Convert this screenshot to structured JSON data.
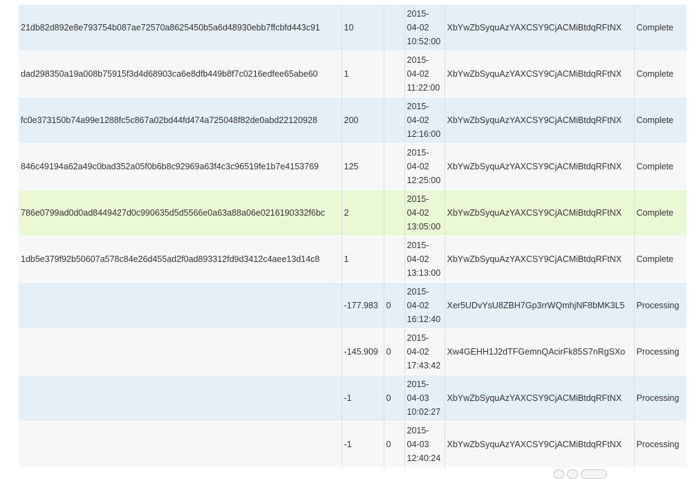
{
  "transactions": {
    "rows": [
      {
        "hash": "21db82d892e8e793754b087ae72570a8625450b5a6d48930ebb7ffcbfd443c91",
        "amount": "10",
        "confirmations": "",
        "date": "2015-",
        "date2": "04-02",
        "time": "10:52:00",
        "address": "XbYwZbSyquAzYAXCSY9CjACMiBtdqRFtNX",
        "status": "Complete"
      },
      {
        "hash": "dad298350a19a008b75915f3d4d68903ca6e8dfb449b8f7c0216edfee65abe60",
        "amount": "1",
        "confirmations": "",
        "date": "2015-",
        "date2": "04-02",
        "time": "11:22:00",
        "address": "XbYwZbSyquAzYAXCSY9CjACMiBtdqRFtNX",
        "status": "Complete"
      },
      {
        "hash": "fc0e373150b74a99e1288fc5c867a02bd44fd474a725048f82de0abd22120928",
        "amount": "200",
        "confirmations": "",
        "date": "2015-",
        "date2": "04-02",
        "time": "12:16:00",
        "address": "XbYwZbSyquAzYAXCSY9CjACMiBtdqRFtNX",
        "status": "Complete"
      },
      {
        "hash": "846c49194a62a49c0bad352a05f0b6b8c92969a63f4c3c96519fe1b7e4153769",
        "amount": "125",
        "confirmations": "",
        "date": "2015-",
        "date2": "04-02",
        "time": "12:25:00",
        "address": "XbYwZbSyquAzYAXCSY9CjACMiBtdqRFtNX",
        "status": "Complete"
      },
      {
        "hash": "786e0799ad0d0ad8449427d0c990635d5d5566e0a63a88a06e0216190332f6bc",
        "amount": "2",
        "confirmations": "",
        "date": "2015-",
        "date2": "04-02",
        "time": "13:05:00",
        "address": "XbYwZbSyquAzYAXCSY9CjACMiBtdqRFtNX",
        "status": "Complete"
      },
      {
        "hash": "1db5e379f92b50607a578c84e26d455ad2f0ad893312fd9d3412c4aee13d14c8",
        "amount": "1",
        "confirmations": "",
        "date": "2015-",
        "date2": "04-02",
        "time": "13:13:00",
        "address": "XbYwZbSyquAzYAXCSY9CjACMiBtdqRFtNX",
        "status": "Complete"
      },
      {
        "hash": "",
        "amount": "-177.983",
        "confirmations": "0",
        "date": "2015-",
        "date2": "04-02",
        "time": "16:12:40",
        "address": "Xer5UDvYsU8ZBH7Gp3rrWQmhjNF8bMK3L5",
        "status": "Processing"
      },
      {
        "hash": "",
        "amount": "-145.909",
        "confirmations": "0",
        "date": "2015-",
        "date2": "04-02",
        "time": "17:43:42",
        "address": "Xw4GEHH1J2dTFGemnQAcirFk85S7nRgSXo",
        "status": "Processing"
      },
      {
        "hash": "",
        "amount": "-1",
        "confirmations": "0",
        "date": "2015-",
        "date2": "04-03",
        "time": "10:02:27",
        "address": "XbYwZbSyquAzYAXCSY9CjACMiBtdqRFtNX",
        "status": "Processing"
      },
      {
        "hash": "",
        "amount": "-1",
        "confirmations": "0",
        "date": "2015-",
        "date2": "04-03",
        "time": "12:40:24",
        "address": "XbYwZbSyquAzYAXCSY9CjACMiBtdqRFtNX",
        "status": "Processing"
      }
    ]
  },
  "colors": {
    "row_even": "#e5eff7",
    "row_odd": "#f7f7f7",
    "row_highlight": "#eaf9d5",
    "text": "#333333"
  }
}
